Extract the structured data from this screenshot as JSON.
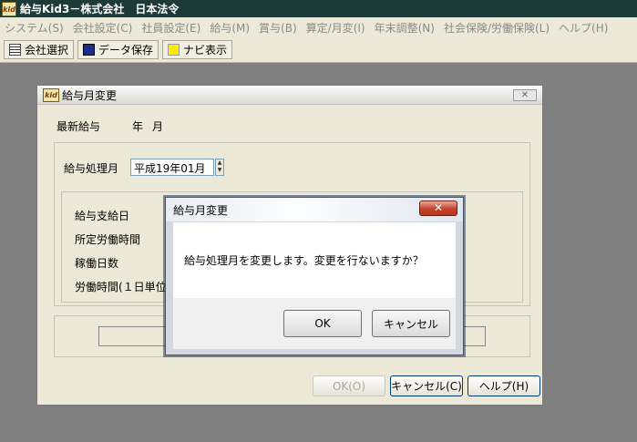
{
  "window": {
    "title": "給与Kid3－株式会社　日本法令",
    "app_icon_label": "kid"
  },
  "menu": [
    "システム(S)",
    "会社設定(C)",
    "社員設定(E)",
    "給与(M)",
    "賞与(B)",
    "算定/月変(I)",
    "年末調整(N)",
    "社会保険/労働保険(L)",
    "ヘルプ(H)"
  ],
  "toolbar": {
    "company_select": "会社選択",
    "data_save": "データ保存",
    "navi_display": "ナビ表示"
  },
  "main_dialog": {
    "title": "給与月変更",
    "icon_label": "kid",
    "latest_pay_label": "最新給与",
    "year_label": "年",
    "month_label": "月",
    "process_month_label": "給与処理月",
    "process_month_value": "平成19年01月",
    "fields": [
      "給与支給日",
      "所定労働時間",
      "稼働日数",
      "労働時間(１日単位"
    ],
    "ok_button": "OK(O)",
    "cancel_button": "キャンセル(C)",
    "help_button": "ヘルプ(H)"
  },
  "confirm_dialog": {
    "title": "給与月変更",
    "message": "給与処理月を変更します。変更を行ないますか？",
    "ok_button": "OK",
    "cancel_button": "キャンセル"
  }
}
